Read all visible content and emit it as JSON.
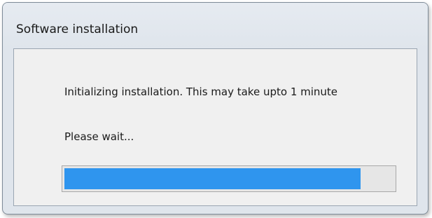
{
  "window": {
    "title": "Software installation"
  },
  "content": {
    "message": "Initializing installation. This may take upto 1 minute",
    "status": "Please wait..."
  },
  "progress": {
    "fraction": 0.9,
    "fill_color": "#2f95ee",
    "track_color": "#e6e6e6"
  }
}
